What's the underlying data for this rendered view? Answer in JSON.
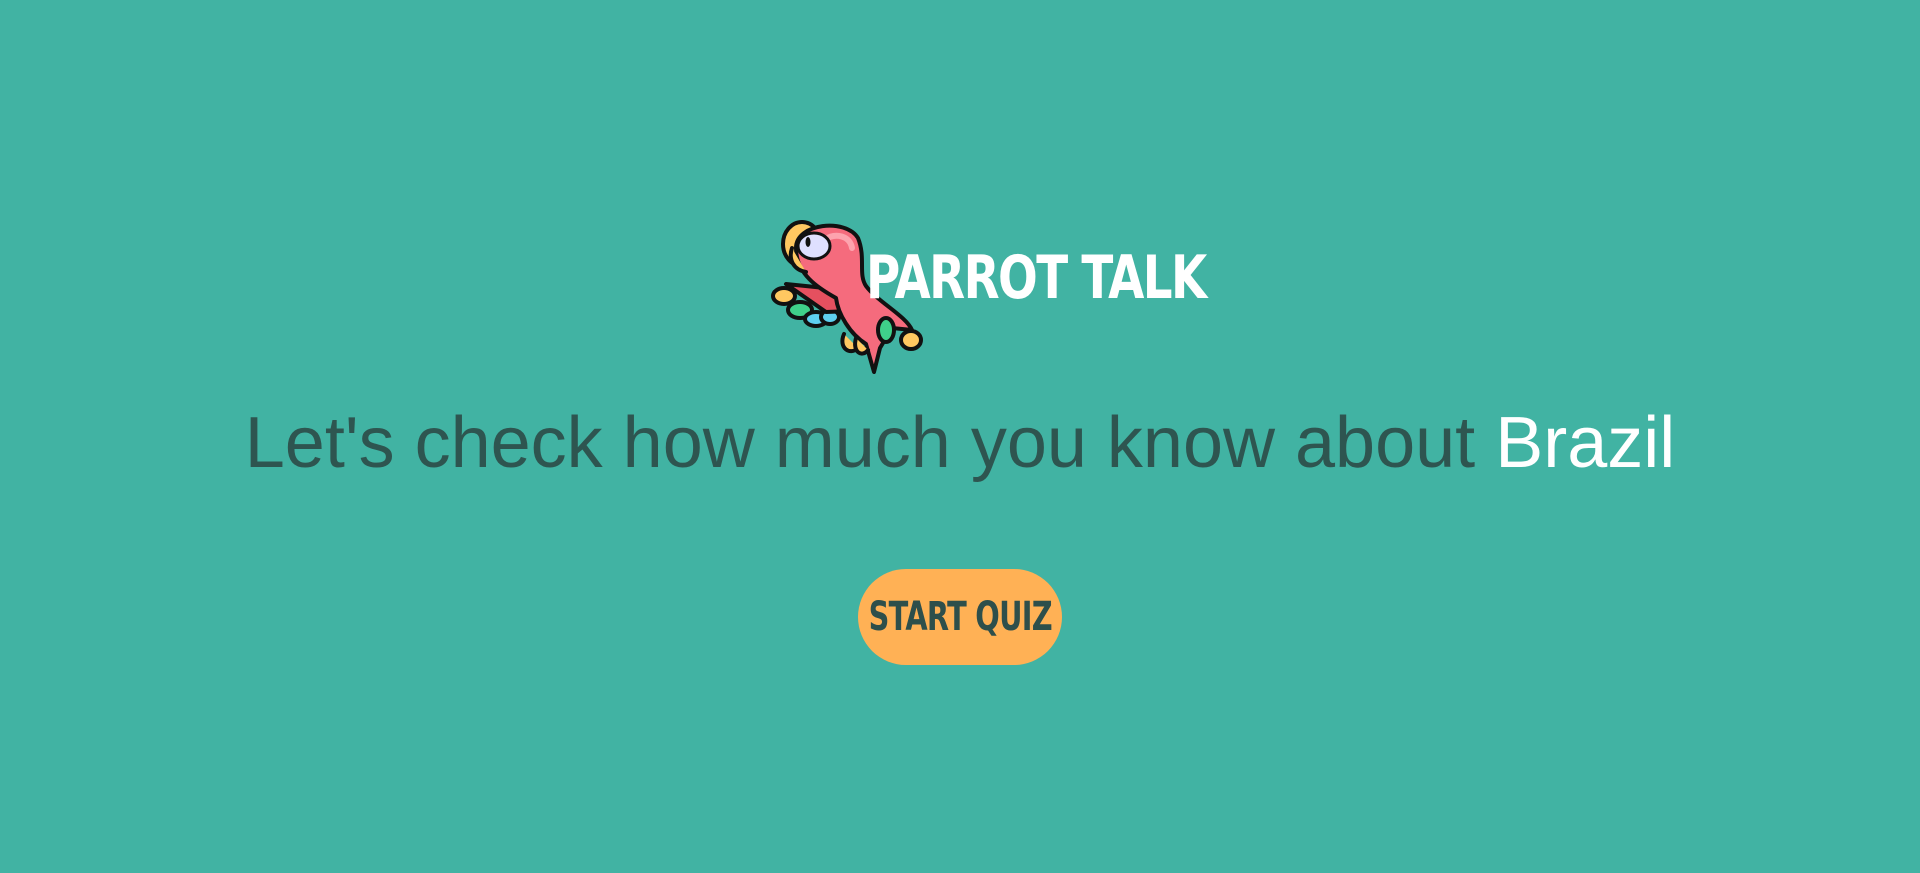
{
  "brand": {
    "logo_icon": "parrot-icon",
    "title": "PARROT TALK"
  },
  "hero": {
    "headline_prefix": "Let's check how much you know about ",
    "country": "Brazil"
  },
  "actions": {
    "start_label": "START QUIZ"
  },
  "colors": {
    "background": "#41b3a3",
    "headline_text": "#2e5550",
    "highlight_text": "#ffffff",
    "button": "#ffb155",
    "button_text": "#2e4f4b"
  }
}
